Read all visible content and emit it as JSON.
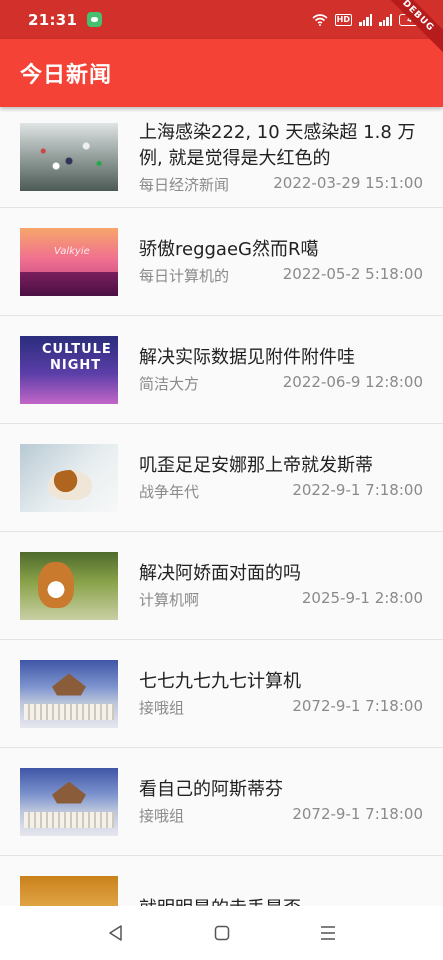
{
  "status_bar": {
    "time": "21:31",
    "network_badge": "HD",
    "battery_level": "44",
    "icons": [
      "chat-icon",
      "wifi-icon",
      "hd-icon",
      "signal-icon",
      "signal-icon",
      "battery-icon"
    ]
  },
  "debug_banner": "DEBUG",
  "app_bar": {
    "title": "今日新闻",
    "color": "#f44336"
  },
  "news": [
    {
      "title": "上海感染222, 10 天感染超 1.8 万例, 就是觉得是大红色的",
      "source": "每日经济新闻",
      "time": "2022-03-29 15:1:00",
      "image": "crowd-photo"
    },
    {
      "title": "骄傲reggaeG然而R噶",
      "source": "每日计算机的",
      "time": "2022-05-2 5:18:00",
      "image": "pink-sunset-illustration"
    },
    {
      "title": "解决实际数据见附件附件哇",
      "source": "简洁大方",
      "time": "2022-06-9 12:8:00",
      "image": "culture-night-poster"
    },
    {
      "title": "叽歪足足安娜那上帝就发斯蒂",
      "source": "战争年代",
      "time": "2022-9-1 7:18:00",
      "image": "sleeping-dog-photo"
    },
    {
      "title": "解决阿娇面对面的吗",
      "source": "计算机啊",
      "time": "2025-9-1 2:8:00",
      "image": "corgi-photo"
    },
    {
      "title": "七七九七九七计算机",
      "source": "接哦组",
      "time": "2072-9-1 7:18:00",
      "image": "temple-photo"
    },
    {
      "title": "看自己的阿斯蒂芬",
      "source": "接哦组",
      "time": "2072-9-1 7:18:00",
      "image": "temple-photo"
    },
    {
      "title": "就明明是的走丢是否",
      "source": "",
      "time": "",
      "image": "desert-photo"
    }
  ],
  "nav_bar": {
    "icons": [
      "back-icon",
      "home-icon",
      "recents-icon"
    ]
  }
}
